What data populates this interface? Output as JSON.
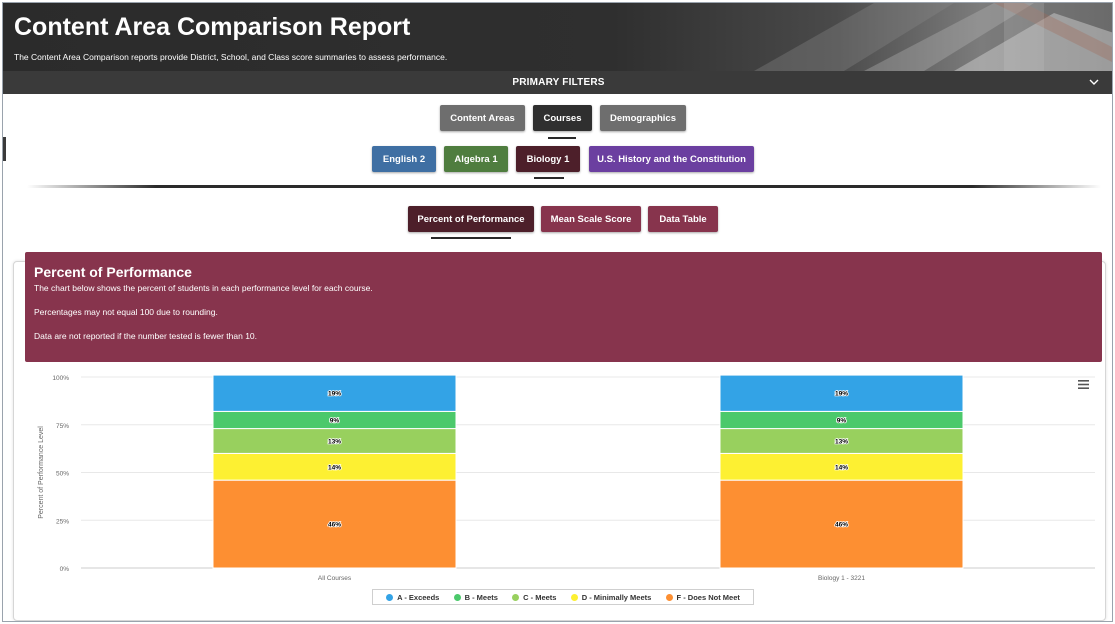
{
  "header": {
    "title": "Content Area Comparison Report",
    "subtitle": "The Content Area Comparison reports provide District, School, and Class score summaries to assess performance."
  },
  "filters": {
    "title": "PRIMARY FILTERS",
    "chevron_icon": "chevron-down-icon",
    "tabs": [
      {
        "label": "Content Areas",
        "color": "#6e6e6e",
        "selected": false
      },
      {
        "label": "Courses",
        "color": "#2f2f2f",
        "selected": true
      },
      {
        "label": "Demographics",
        "color": "#6e6e6e",
        "selected": false
      }
    ],
    "courses": [
      {
        "label": "English 2",
        "color": "#3f6fa3",
        "selected": false
      },
      {
        "label": "Algebra 1",
        "color": "#4f7d3f",
        "selected": false
      },
      {
        "label": "Biology 1",
        "color": "#4d1f2a",
        "selected": true
      },
      {
        "label": "U.S. History and the Constitution",
        "color": "#6b3fa0",
        "selected": false
      }
    ]
  },
  "views": [
    {
      "label": "Percent of Performance",
      "color": "#4d1f2a",
      "selected": true
    },
    {
      "label": "Mean Scale Score",
      "color": "#87344d",
      "selected": false
    },
    {
      "label": "Data Table",
      "color": "#87344d",
      "selected": false
    }
  ],
  "info": {
    "title": "Percent of Performance",
    "line1": "The chart below shows the percent of students in each performance level for each course.",
    "line2": "Percentages may not equal 100 due to rounding.",
    "line3": "Data are not reported if the number tested is fewer than 10."
  },
  "chart_menu_icon": "hamburger-menu-icon",
  "chart_data": {
    "type": "bar",
    "stacked": true,
    "categories": [
      "All Courses",
      "Biology 1 - 3221"
    ],
    "ylabel": "Percent of Performance Level",
    "ylim": [
      0,
      100
    ],
    "yticks": [
      "0%",
      "25%",
      "50%",
      "75%",
      "100%"
    ],
    "legend_position": "bottom-center",
    "series": [
      {
        "name": "F - Does Not Meet",
        "color": "#fd8f32",
        "values": [
          46,
          46
        ]
      },
      {
        "name": "D - Minimally Meets",
        "color": "#fdf032",
        "values": [
          14,
          14
        ]
      },
      {
        "name": "C - Meets",
        "color": "#98d05e",
        "values": [
          13,
          13
        ]
      },
      {
        "name": "B - Meets",
        "color": "#4bc96b",
        "values": [
          9,
          9
        ]
      },
      {
        "name": "A - Exceeds",
        "color": "#33a3e6",
        "values": [
          19,
          19
        ]
      }
    ],
    "legend_order": [
      "A - Exceeds",
      "B - Meets",
      "C - Meets",
      "D - Minimally Meets",
      "F - Does Not Meet"
    ]
  }
}
